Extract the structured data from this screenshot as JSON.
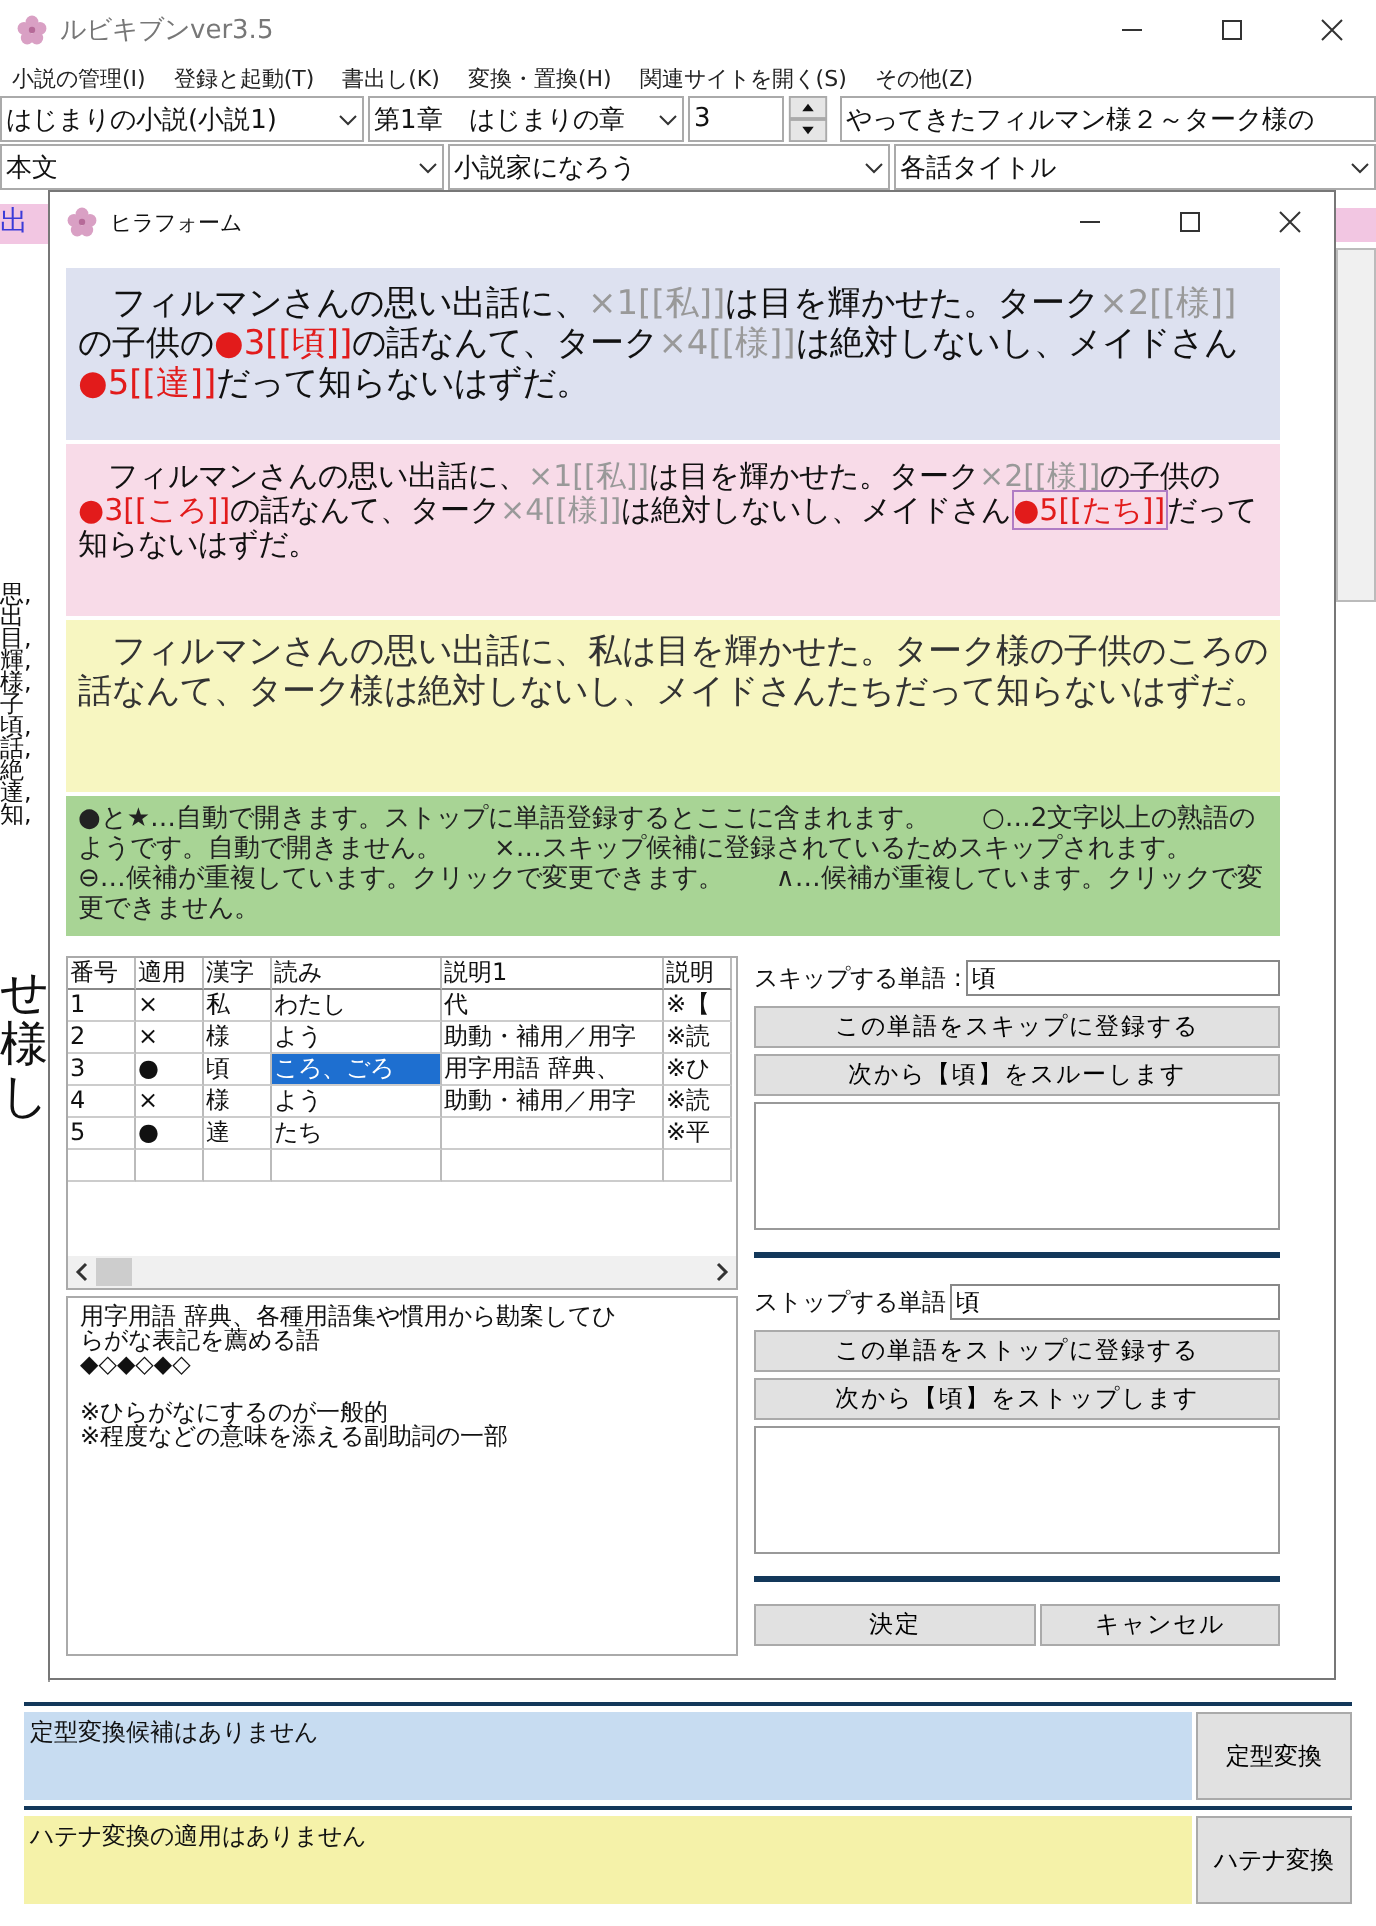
{
  "window": {
    "title": "ルビキブンver3.5"
  },
  "menu": [
    "小説の管理(I)",
    "登録と起動(T)",
    "書出し(K)",
    "変換・置換(H)",
    "関連サイトを開く(S)",
    "その他(Z)"
  ],
  "toolbar": {
    "novel": "はじまりの小説(小説1)",
    "chapter": "第1章　はじまりの章",
    "episode_number": "3",
    "episode_title": "やってきたフィルマン様２～ターク様の",
    "section": "本文",
    "site": "小説家になろう",
    "title_mode": "各話タイトル"
  },
  "background": {
    "tab": "出",
    "words": [
      "思,",
      "出",
      "目,",
      "輝,",
      "様,",
      "子",
      "頃,",
      "話,",
      "絶",
      "達,",
      "知,"
    ],
    "large_text": [
      "せ",
      "様",
      "し"
    ]
  },
  "dialog": {
    "title": "ヒラフォーム",
    "marked_text": [
      {
        "kind": "plain",
        "text": "　フィルマンさんの思い出話に、"
      },
      {
        "kind": "skip",
        "text": "×1[[私]]"
      },
      {
        "kind": "plain",
        "text": "は目を輝かせた。ターク"
      },
      {
        "kind": "skip",
        "text": "×2[[様]]"
      },
      {
        "kind": "plain",
        "text": "の子供の"
      },
      {
        "kind": "apply",
        "text": "●3[[頃]]"
      },
      {
        "kind": "plain",
        "text": "の話なんて、ターク"
      },
      {
        "kind": "skip",
        "text": "×4[[様]]"
      },
      {
        "kind": "plain",
        "text": "は絶対しないし、メイドさん"
      },
      {
        "kind": "apply",
        "text": "●5[[達]]"
      },
      {
        "kind": "plain",
        "text": "だって知らないはずだ。"
      }
    ],
    "reading_text": [
      {
        "kind": "plain",
        "text": "　フィルマンさんの思い出話に、",
        "selected": false
      },
      {
        "kind": "skip",
        "text": "×1[[私]]",
        "selected": false
      },
      {
        "kind": "plain",
        "text": "は目を輝かせた。ターク",
        "selected": false
      },
      {
        "kind": "skip",
        "text": "×2[[様]]",
        "selected": false
      },
      {
        "kind": "plain",
        "text": "の子供の",
        "selected": false
      },
      {
        "kind": "apply",
        "text": "●3[[ころ]]",
        "selected": false
      },
      {
        "kind": "plain",
        "text": "の話なんて、ターク",
        "selected": false
      },
      {
        "kind": "skip",
        "text": "×4[[様]]",
        "selected": false
      },
      {
        "kind": "plain",
        "text": "は絶対しないし、メイドさん",
        "selected": false
      },
      {
        "kind": "apply",
        "text": "●5[[たち]]",
        "selected": true
      },
      {
        "kind": "plain",
        "text": "だって知らないはずだ。",
        "selected": false
      }
    ],
    "result_text": "　フィルマンさんの思い出話に、私は目を輝かせた。ターク様の子供のころの話なんて、ターク様は絶対しないし、メイドさんたちだって知らないはずだ。",
    "legend": "●と★…自動で開きます。ストップに単語登録するとここに含まれます。　　○…2文字以上の熟語のようです。自動で開きません。　　×…スキップ候補に登録されているためスキップされます。　　⊖…候補が重複しています。クリックで変更できます。　　∧…候補が重複しています。クリックで変更できません。",
    "table": {
      "columns": [
        "番号",
        "適用",
        "漢字",
        "読み",
        "説明1",
        "説明"
      ],
      "rows": [
        {
          "cells": [
            "1",
            "×",
            "私",
            "わたし",
            "代",
            "※【"
          ],
          "selected": false
        },
        {
          "cells": [
            "2",
            "×",
            "様",
            "よう",
            "助動・補用／用字",
            "※読"
          ],
          "selected": false
        },
        {
          "cells": [
            "3",
            "●",
            "頃",
            "ころ、ごろ",
            "用字用語 辞典、",
            "※ひ"
          ],
          "selected": true
        },
        {
          "cells": [
            "4",
            "×",
            "様",
            "よう",
            "助動・補用／用字",
            "※読"
          ],
          "selected": false
        },
        {
          "cells": [
            "5",
            "●",
            "達",
            "たち",
            "",
            "※平"
          ],
          "selected": false
        }
      ]
    },
    "detail": [
      "用字用語 辞典、各種用語集や慣用から勘案してひらがな表記を薦める語",
      "◆◇◆◇◆◇",
      "※ひらがなにするのが一般的",
      "※程度などの意味を添える副助詞の一部"
    ],
    "skip": {
      "label": "スキップする単語 :",
      "value": "頃",
      "buttons": [
        "この単語をスキップに登録する",
        "次から【頃】をスルーします"
      ]
    },
    "stop": {
      "label": "ストップする単語",
      "value": "頃",
      "buttons": [
        "この単語をストップに登録する",
        "次から【頃】をストップします"
      ]
    },
    "buttons": [
      "決定",
      "キャンセル"
    ]
  },
  "bottom": [
    {
      "message": "定型変換候補はありません",
      "button": "定型変換",
      "kind": "blue"
    },
    {
      "message": "ハテナ変換の適用はありません",
      "button": "ハテナ変換",
      "kind": "yellow"
    }
  ]
}
